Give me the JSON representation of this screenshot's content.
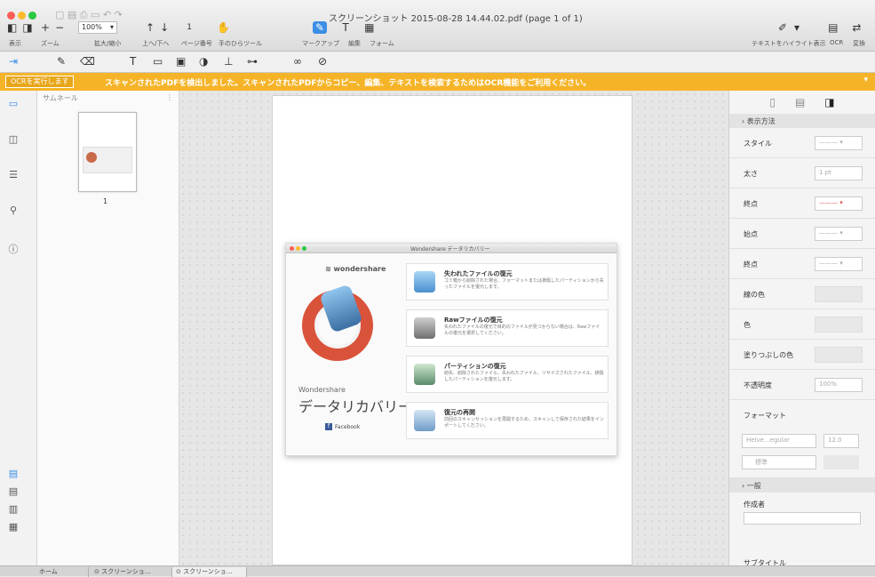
{
  "window": {
    "title": "スクリーンショット 2015-08-28 14.44.02.pdf (page 1 of 1)"
  },
  "toolbar": {
    "zoom_value": "100%",
    "page_value": "1",
    "labels": {
      "view": "表示",
      "zoom": "ズーム",
      "zoom_level": "拡大/縮小",
      "up_down": "上へ/下へ",
      "page_number": "ページ番号",
      "hand_tool": "手のひらツール",
      "markup": "マークアップ",
      "edit": "編集",
      "form": "フォーム",
      "text_highlight": "テキストをハイライト表示",
      "ocr": "OCR",
      "convert": "変換"
    }
  },
  "banner": {
    "ocr_button": "OCRを実行します",
    "message": "スキャンされたPDFを検出しました。スキャンされたPDFからコピー、編集、テキストを検索するためはOCR機能をご利用ください。"
  },
  "thumbnails": {
    "header": "サムネール",
    "page_label": "1"
  },
  "document": {
    "app_window_title": "Wondershare データリカバリー",
    "logo_text": "wondershare",
    "brand_sub": "Wondershare",
    "brand_title": "データリカバリー",
    "facebook": "Facebook",
    "cards": [
      {
        "title": "失われたファイルの復元",
        "desc": "ゴミ箱から削除された場合、フォーマットまたは損傷したパーティションから失ったファイルを復元します。"
      },
      {
        "title": "Rawファイルの復元",
        "desc": "失われたファイルの復元で目的のファイルが見つからない場合は、Rawファイルの復元を選択してください。"
      },
      {
        "title": "パーティションの復元",
        "desc": "紛失、削除されたファイル、失われたファイル、リサイズされたファイル、損傷したパーティションを復元します。"
      },
      {
        "title": "復元の再開",
        "desc": "前回のスキャンセッションを再開するため、スキャンして保存された結果をインポートしてください。"
      }
    ]
  },
  "properties": {
    "section_display": "表示方法",
    "rows": [
      {
        "label": "スタイル",
        "value": ""
      },
      {
        "label": "太さ",
        "value": "1 pt"
      },
      {
        "label": "終点",
        "value": ""
      },
      {
        "label": "始点",
        "value": ""
      },
      {
        "label": "終点",
        "value": ""
      },
      {
        "label": "線の色",
        "value": ""
      },
      {
        "label": "色",
        "value": ""
      },
      {
        "label": "塗りつぶしの色",
        "value": ""
      },
      {
        "label": "不透明度",
        "value": "100%"
      }
    ],
    "format_label": "フォーマット",
    "font_value": "Helve...egular",
    "font_size": "12.0",
    "align_value": "標準",
    "section_general": "一般",
    "author_label": "作成者",
    "subtitle_label": "サブタイトル"
  },
  "tabs": [
    {
      "label": "ホーム"
    },
    {
      "label": "スクリーンショ…"
    },
    {
      "label": "スクリーンショ…"
    }
  ],
  "colors": {
    "banner": "#f5b428",
    "accent": "#3a8ee6"
  }
}
